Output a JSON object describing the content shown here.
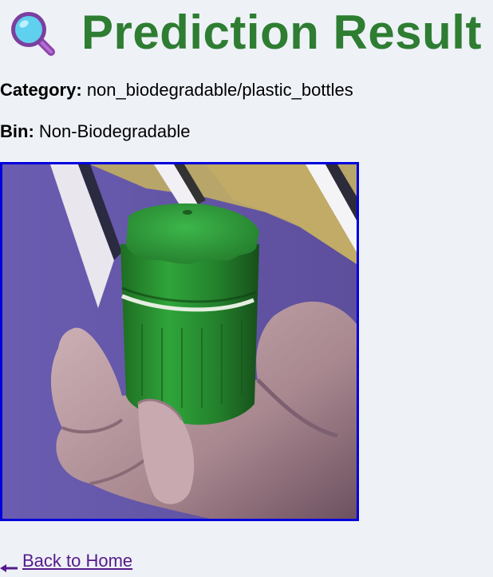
{
  "header": {
    "title": "Prediction Result",
    "icon": "magnifying-glass-icon"
  },
  "result": {
    "category_label": "Category:",
    "category_value": "non_biodegradable/plastic_bottles",
    "bin_label": "Bin:",
    "bin_value": "Non-Biodegradable"
  },
  "image": {
    "subject": "uploaded-photo-green-bottle-cap",
    "border_color": "#0000dd"
  },
  "footer": {
    "back_link_label": "Back to Home",
    "arrow_icon": "left-arrow-icon"
  },
  "colors": {
    "title": "#2e7d32",
    "background": "#eef2f7",
    "link": "#551a8b"
  }
}
